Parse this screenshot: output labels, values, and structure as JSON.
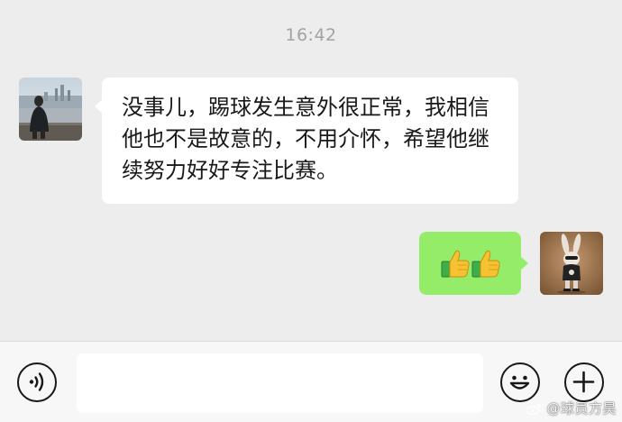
{
  "chat": {
    "timestamp": "16:42",
    "messages": [
      {
        "sender": "other",
        "avatar": "person-by-waterfront-avatar",
        "text": "没事儿，踢球发生意外很正常，我相信他也不是故意的，不用介怀，希望他继续努力好好专注比赛。"
      },
      {
        "sender": "self",
        "avatar": "bunny-figure-avatar",
        "emojis": [
          "thumbs-up-emoji",
          "thumbs-up-emoji"
        ]
      }
    ]
  },
  "input_bar": {
    "voice_icon": "voice-icon",
    "input_value": "",
    "emoji_icon": "smiley-icon",
    "more_icon": "plus-icon"
  },
  "watermark": {
    "text": "@球员方昊",
    "icon": "weibo-logo-icon"
  },
  "colors": {
    "background": "#ededed",
    "self_bubble": "#95ec69",
    "other_bubble": "#ffffff",
    "input_bar": "#f7f7f7"
  }
}
